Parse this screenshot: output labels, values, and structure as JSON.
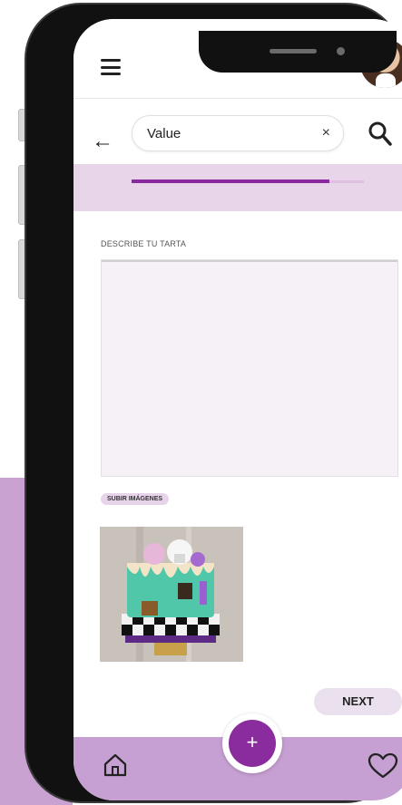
{
  "search": {
    "value": "Value",
    "clear_glyph": "×"
  },
  "header": {
    "menu_icon": "hamburger-menu-icon",
    "avatar": "user-avatar"
  },
  "progress": {
    "fraction": 0.85
  },
  "form": {
    "describe_label": "DESCRIBE TU TARTA",
    "upload_label": "SUBIR IMÁGENES"
  },
  "actions": {
    "next_label": "NEXT"
  },
  "nav": {
    "add_glyph": "+",
    "home_icon": "home-icon",
    "favorites_icon": "heart-icon"
  },
  "colors": {
    "accent": "#8a2c9e",
    "nav_bg": "#c7a0d3",
    "progress_band": "#e8d5ea"
  }
}
